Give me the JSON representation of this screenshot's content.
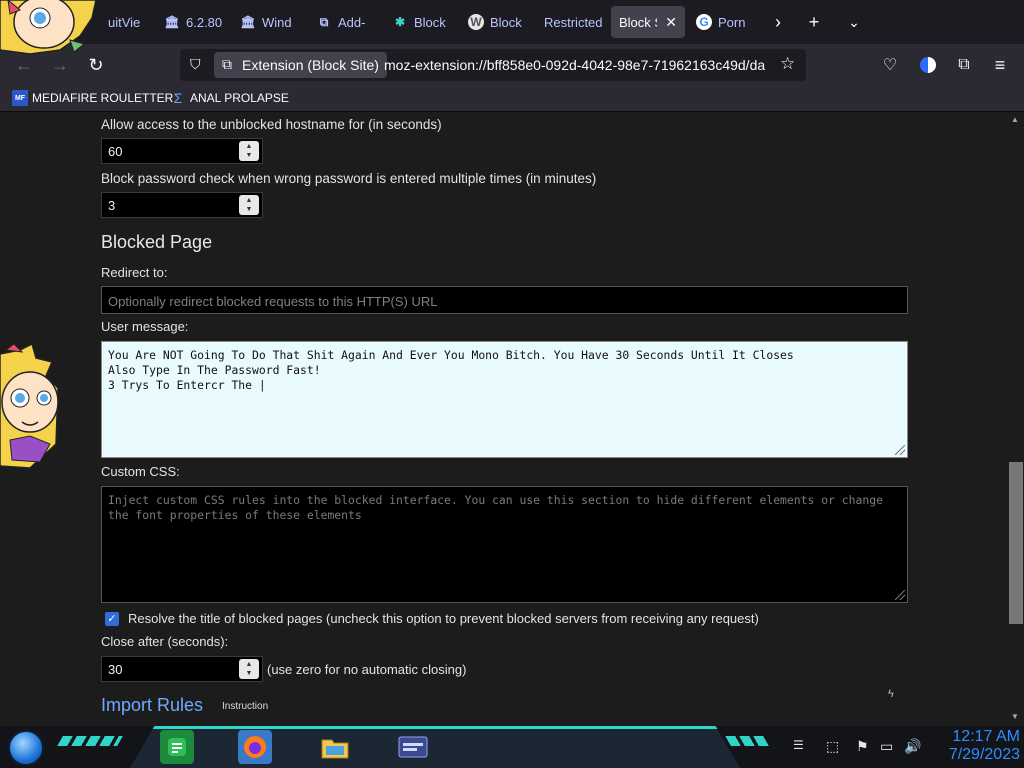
{
  "tabs": [
    {
      "label": "uitVie",
      "icon": "ui"
    },
    {
      "label": "6.2.80",
      "icon": "bank"
    },
    {
      "label": "Wind",
      "icon": "bank"
    },
    {
      "label": "Add-",
      "icon": "puzzle"
    },
    {
      "label": "Block",
      "icon": "fox"
    },
    {
      "label": "Block",
      "icon": "w"
    },
    {
      "label": "Restricted",
      "icon": "none"
    },
    {
      "label": "Block S",
      "icon": "none"
    },
    {
      "label": "Porn",
      "icon": "google"
    }
  ],
  "toolbar": {
    "extension_pill": "Extension (Block Site)",
    "url": "moz-extension://bff858e0-092d-4042-98e7-71962163c49d/da"
  },
  "bookmarks": [
    {
      "label": "MEDIAFIRE ROULETTER",
      "icon_text": "MF"
    },
    {
      "label": "ANAL PROLAPSE",
      "icon_text": "Σ"
    }
  ],
  "settings": {
    "allow_access_label": "Allow access to the unblocked hostname for (in seconds)",
    "allow_access_value": "60",
    "block_pw_label": "Block password check when wrong password is entered multiple times (in minutes)",
    "block_pw_value": "3",
    "blocked_page_heading": "Blocked Page",
    "redirect_label": "Redirect to:",
    "redirect_placeholder": "Optionally redirect blocked requests to this HTTP(S) URL",
    "user_message_label": "User message:",
    "user_message_value": "You Are NOT Going To Do That Shit Again And Ever You Mono Bitch. You Have 30 Seconds Until It Closes\nAlso Type In The Password Fast!\n3 Trys To Entercr The |",
    "custom_css_label": "Custom CSS:",
    "custom_css_placeholder": "Inject custom CSS rules into the blocked interface. You can use this section to hide different elements or change\nthe font properties of these elements",
    "resolve_title_label": "Resolve the title of blocked pages (uncheck this option to prevent blocked servers from receiving any request)",
    "resolve_title_checked": true,
    "close_after_label": "Close after (seconds):",
    "close_after_value": "30",
    "close_after_hint": "(use zero for no automatic closing)",
    "import_rules_heading": "Import Rules",
    "instruction_link": "Instruction"
  },
  "taskbar": {
    "clock_time": "12:17 AM",
    "clock_date": "7/29/2023"
  },
  "colors": {
    "accent_blue": "#2d8cff",
    "link_blue": "#6fa9ff",
    "checkbox": "#2f6ed8"
  }
}
